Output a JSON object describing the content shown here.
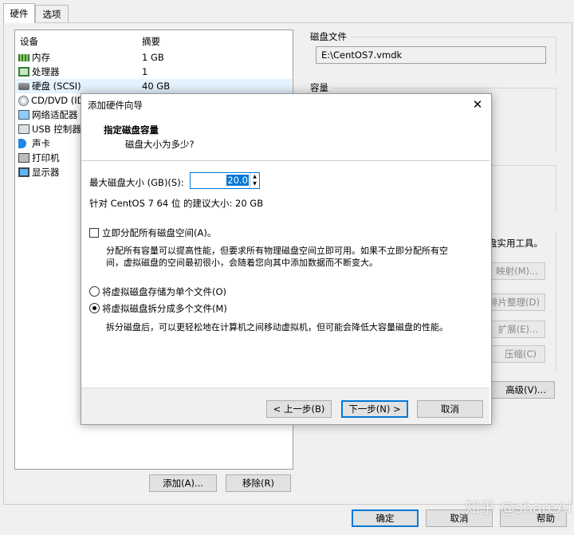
{
  "tabs": [
    "硬件",
    "选项"
  ],
  "devices": {
    "headers": [
      "设备",
      "摘要"
    ],
    "rows": [
      {
        "name": "内存",
        "summary": "1 GB",
        "icon": "memory-icon"
      },
      {
        "name": "处理器",
        "summary": "1",
        "icon": "cpu-icon"
      },
      {
        "name": "硬盘 (SCSI)",
        "summary": "40 GB",
        "icon": "hard-disk-icon"
      },
      {
        "name": "CD/DVD (ID",
        "summary": "",
        "icon": "cd-dvd-icon"
      },
      {
        "name": "网络适配器",
        "summary": "",
        "icon": "network-adapter-icon"
      },
      {
        "name": "USB 控制器",
        "summary": "",
        "icon": "usb-icon"
      },
      {
        "name": "声卡",
        "summary": "",
        "icon": "sound-card-icon"
      },
      {
        "name": "打印机",
        "summary": "",
        "icon": "printer-icon"
      },
      {
        "name": "显示器",
        "summary": "",
        "icon": "monitor-icon"
      }
    ]
  },
  "add_button": "添加(A)...",
  "remove_button": "移除(R)",
  "disk_file": {
    "title": "磁盘文件",
    "value": "E:\\CentOS7.vmdk"
  },
  "capacity_title": "容量",
  "utilities": {
    "text": "盘实用工具。",
    "map": "映射(M)...",
    "defrag": "碎片整理(D)",
    "expand": "扩展(E)...",
    "compact": "压缩(C)"
  },
  "advanced_button": "高级(V)...",
  "bottom": {
    "ok": "确定",
    "cancel": "取消",
    "help": "帮助"
  },
  "watermark": "知乎 @shareAI",
  "dialog": {
    "title": "添加硬件向导",
    "heading": "指定磁盘容量",
    "subheading": "磁盘大小为多少?",
    "max_size_label": "最大磁盘大小 (GB)(S):",
    "max_size_value": "20.0",
    "recommend": "针对 CentOS 7 64 位 的建议大小: 20 GB",
    "allocate_label": "立即分配所有磁盘空间(A)。",
    "allocate_desc_1": "分配所有容量可以提高性能，但要求所有物理磁盘空间立即可用。如果不立即分配所有空",
    "allocate_desc_2": "间，虚拟磁盘的空间最初很小，会随着您向其中添加数据而不断变大。",
    "single_file": "将虚拟磁盘存储为单个文件(O)",
    "multi_file": "将虚拟磁盘拆分成多个文件(M)",
    "multi_desc": "拆分磁盘后，可以更轻松地在计算机之间移动虚拟机，但可能会降低大容量磁盘的性能。",
    "back": "< 上一步(B)",
    "next": "下一步(N) >",
    "cancel": "取消"
  }
}
